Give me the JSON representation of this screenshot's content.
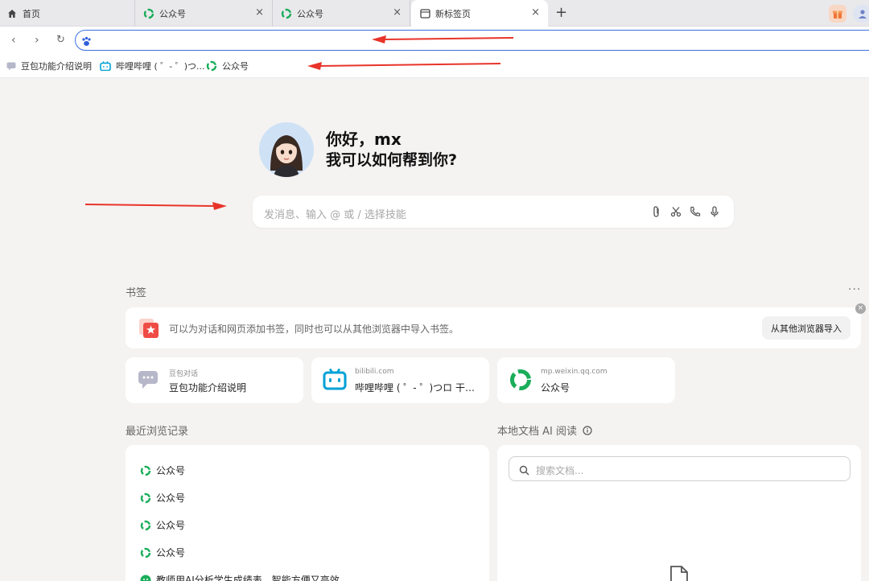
{
  "tabs": [
    {
      "label": "首页",
      "icon": "home-icon"
    },
    {
      "label": "公众号",
      "icon": "wechat-mp-icon",
      "close": "×"
    },
    {
      "label": "公众号",
      "icon": "wechat-mp-icon",
      "close": "×"
    },
    {
      "label": "新标签页",
      "icon": "page-icon",
      "close": "×",
      "active": true
    }
  ],
  "new_tab": "+",
  "nav": {
    "back": "‹",
    "forward": "›",
    "reload": "↻",
    "address_value": ""
  },
  "bookmark_bar": [
    {
      "label": "豆包功能介绍说明",
      "icon": "chat-bubble-icon"
    },
    {
      "label": "哔哩哔哩 ( ゜- ゜)つ...",
      "icon": "bilibili-icon"
    },
    {
      "label": "公众号",
      "icon": "wechat-mp-icon"
    }
  ],
  "hero": {
    "greeting": "你好，mx",
    "question": "我可以如何帮到你?"
  },
  "chat": {
    "placeholder": "发消息、输入 @ 或 / 选择技能"
  },
  "bookmarks": {
    "title": "书签",
    "more": "···",
    "tip": "可以为对话和网页添加书签，同时也可以从其他浏览器中导入书签。",
    "import_button": "从其他浏览器导入",
    "cards": [
      {
        "source": "豆包对话",
        "title": "豆包功能介绍说明",
        "icon": "chat-bubble-icon"
      },
      {
        "source": "bilibili.com",
        "title": "哔哩哔哩 ( ゜- ゜)つロ 干杯...",
        "icon": "bilibili-icon"
      },
      {
        "source": "mp.weixin.qq.com",
        "title": "公众号",
        "icon": "wechat-mp-icon"
      }
    ]
  },
  "recent": {
    "title": "最近浏览记录",
    "items": [
      "公众号",
      "公众号",
      "公众号",
      "公众号",
      "教师用AI分析学生成绩表，智能方便又高效"
    ]
  },
  "local_docs": {
    "title": "本地文档 AI 阅读",
    "search_placeholder": "搜索文档..."
  },
  "colors": {
    "accent": "#3b6fe0",
    "wechat_green": "#1aad5a",
    "bilibili_blue": "#00a1d6",
    "arrow_red": "#e8342a"
  }
}
